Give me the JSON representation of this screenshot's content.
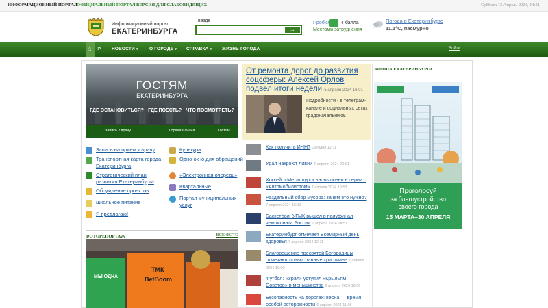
{
  "topbar": {
    "tab_portal": "ИНФОРМАЦИОННЫЙ ПОРТАЛ",
    "tab_official": "ОФИЦИАЛЬНЫЙ ПОРТАЛ",
    "tab_impaired": "ВЕРСИЯ ДЛЯ СЛАБОВИДЯЩИХ",
    "date": "Суббота 13 Апрель 2024, 14:21"
  },
  "header": {
    "logo_small": "Информационный портал",
    "logo_big": "ЕКАТЕРИНБУРГА",
    "search_scope": "везде",
    "search_value": "",
    "search_button": "→"
  },
  "traffic": {
    "label": "Пробки",
    "score": "4 балла",
    "sublabel": "Местами затруднения"
  },
  "weather": {
    "link": "Погода в Екатеринбурге",
    "value": "11.1°C, пасмурно"
  },
  "nav": {
    "home_icon": "⌂",
    "sitemap_icon": "⊳",
    "items": [
      "НОВОСТИ",
      "О ГОРОДЕ",
      "СПРАВКА",
      "ЖИЗНЬ ГОРОДА"
    ],
    "login": "Войти"
  },
  "banner": {
    "title": "ГОСТЯМ",
    "subtitle": "ЕКАТЕРИНБУРГА",
    "questions": "ГДЕ ОСТАНОВИТЬСЯ? · ГДЕ ПОЕСТЬ? · ЧТО ПОСМОТРЕТЬ?",
    "links": [
      "Запись к врачу",
      "Горячая линия",
      "Гостям"
    ]
  },
  "services": {
    "left": [
      "Запись на прием к врачу",
      "Транспортная карта города Екатеринбурга",
      "Стратегический план развития Екатеринбурга",
      "Обсуждение проектов",
      "Школьное питание",
      "Я предлагаю!"
    ],
    "right": [
      "Культура",
      "Одно окно для обращений",
      "«Электронная очередь»",
      "Квартальные",
      "Портал муниципальных услуг"
    ]
  },
  "photo": {
    "header": "ФОТОРЕПОРТАЖ",
    "all_link": "ВСЕ ФОТО",
    "caption_a": "ТМК",
    "caption_b": "BetBoom",
    "caption_c": "МЫ ОДНА"
  },
  "feature": {
    "title": "От ремонта дорог до развития соцсферы: Алексей Орлов подвел итоги недели",
    "date": "5 апреля 2024 16:01",
    "text": "Подробности - в телеграм-канале и социальных сетях градоначальника."
  },
  "news": [
    {
      "title": "Как получить ИНН?",
      "date": "Сегодня 12:11"
    },
    {
      "title": "Урал накроют ливни",
      "date": "7 апреля 2024 20:01"
    },
    {
      "title": "Хоккей: «Металлург» вновь повел в серии с «Автомобилистом»",
      "date": "7 апреля 2024 19:53"
    },
    {
      "title": "Раздельный сбор мусора: зачем это нужно?",
      "date": "7 апреля 2024 15:13"
    },
    {
      "title": "Баскетбол: УГМК вышел в полуфинал чемпионата России",
      "date": "7 апреля 2024 14:51"
    },
    {
      "title": "Екатеринбург отмечает Всемирный день здоровья",
      "date": "7 апреля 2024 12:11"
    },
    {
      "title": "Благовещение пресвятой Богородицы отмечают православные христиане",
      "date": "7 апреля 2024 10:00"
    },
    {
      "title": "Футбол: «Урал» уступил «Крыльям Советов» в меньшинстве",
      "date": "6 апреля 2024 19:06"
    },
    {
      "title": "Безопасность на дорогах: весна — время особой осторожности",
      "date": "6 апреля 2024 11:06"
    }
  ],
  "afisha": {
    "header": "АФИША ЕКАТЕРИНБУРГА",
    "line1": "Проголосуй",
    "line2": "за благоустройство",
    "line3": "своего города",
    "line4": "15 МАРТА–30 АПРЕЛЯ"
  },
  "colors": {
    "nav_green": "#2e6e1e",
    "link_blue": "#1c5a9b",
    "feature_bg": "#f6efc9",
    "afisha_green": "#2e9f54"
  }
}
